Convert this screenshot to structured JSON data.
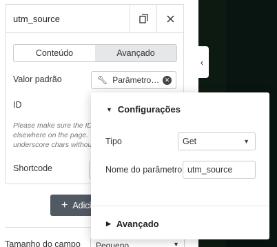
{
  "field": {
    "title": "utm_source",
    "copy_icon": "copy-icon",
    "close_icon": "close-icon"
  },
  "tabs": [
    {
      "label": "Conteúdo",
      "active": false
    },
    {
      "label": "Avançado",
      "active": true
    }
  ],
  "rows": {
    "default_value_label": "Valor padrão",
    "dynamic_tag_value": "Parâmetro ...",
    "id_label": "ID",
    "help_text": "Please make sure the ID is unique and not used elsewhere on the page. This field allows A-z 0-9 & underscore chars without spaces.",
    "shortcode_label": "Shortcode"
  },
  "add_button": {
    "label": "Adicionar item",
    "icon": "plus-icon"
  },
  "bottom": {
    "size_label": "Tamanho do campo",
    "size_value": "Pequeno"
  },
  "popover": {
    "settings_title": "Configurações",
    "type_label": "Tipo",
    "type_value": "Get",
    "param_label": "Nome do parâmetro",
    "param_value": "utm_source",
    "advanced_title": "Avançado"
  },
  "colors": {
    "dark_canvas": "#0d1a12",
    "tab_active_bg": "#e6e7e9",
    "button_bg": "#515962"
  }
}
